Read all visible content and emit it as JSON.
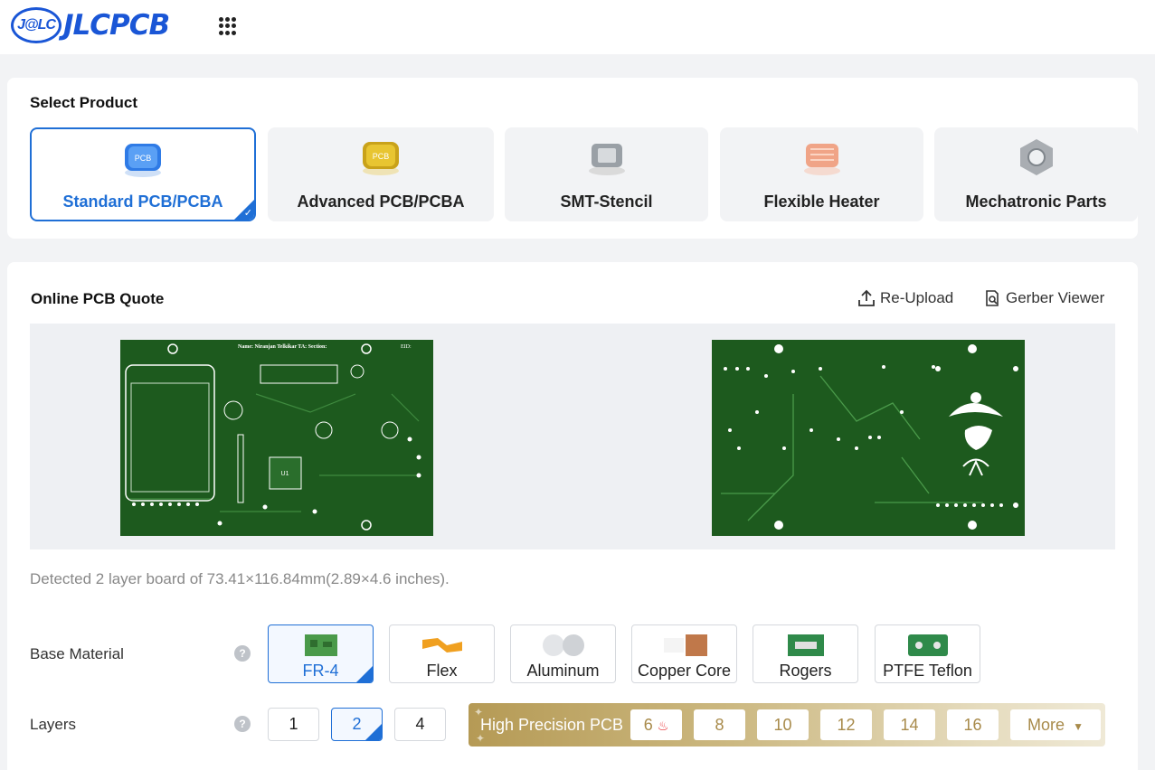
{
  "header": {
    "logo_badge": "J@LC",
    "logo_text": "JLCPCB"
  },
  "select_product": {
    "title": "Select Product",
    "products": [
      {
        "label": "Standard PCB/PCBA",
        "chip_text": "PCB",
        "active": true
      },
      {
        "label": "Advanced PCB/PCBA",
        "chip_text": "PCB",
        "active": false
      },
      {
        "label": "SMT-Stencil",
        "active": false
      },
      {
        "label": "Flexible Heater",
        "active": false
      },
      {
        "label": "Mechatronic Parts",
        "active": false
      }
    ]
  },
  "quote": {
    "title": "Online PCB Quote",
    "reupload_label": "Re-Upload",
    "gerber_viewer_label": "Gerber Viewer",
    "pcb_top_text": "Name: Niranjan Telkikar TA: Section:",
    "pcb_eid_text": "EID:",
    "detected_text": "Detected 2 layer board of 73.41×116.84mm(2.89×4.6 inches)."
  },
  "base_material": {
    "label": "Base Material",
    "options": [
      {
        "label": "FR-4",
        "active": true
      },
      {
        "label": "Flex",
        "active": false
      },
      {
        "label": "Aluminum",
        "active": false
      },
      {
        "label": "Copper Core",
        "active": false
      },
      {
        "label": "Rogers",
        "active": false
      },
      {
        "label": "PTFE Teflon",
        "active": false
      }
    ]
  },
  "layers": {
    "label": "Layers",
    "options": [
      "1",
      "2",
      "4"
    ],
    "selected": "2",
    "high_precision_label": "High Precision PCB",
    "high_precision_options": [
      "6",
      "8",
      "10",
      "12",
      "14",
      "16"
    ],
    "more_label": "More"
  },
  "help_icon_glyph": "?",
  "colors": {
    "brand_blue": "#1a56d6",
    "accent_blue": "#1f6fd6",
    "pcb_green": "#1d5a1e",
    "gold": "#b59a55"
  }
}
